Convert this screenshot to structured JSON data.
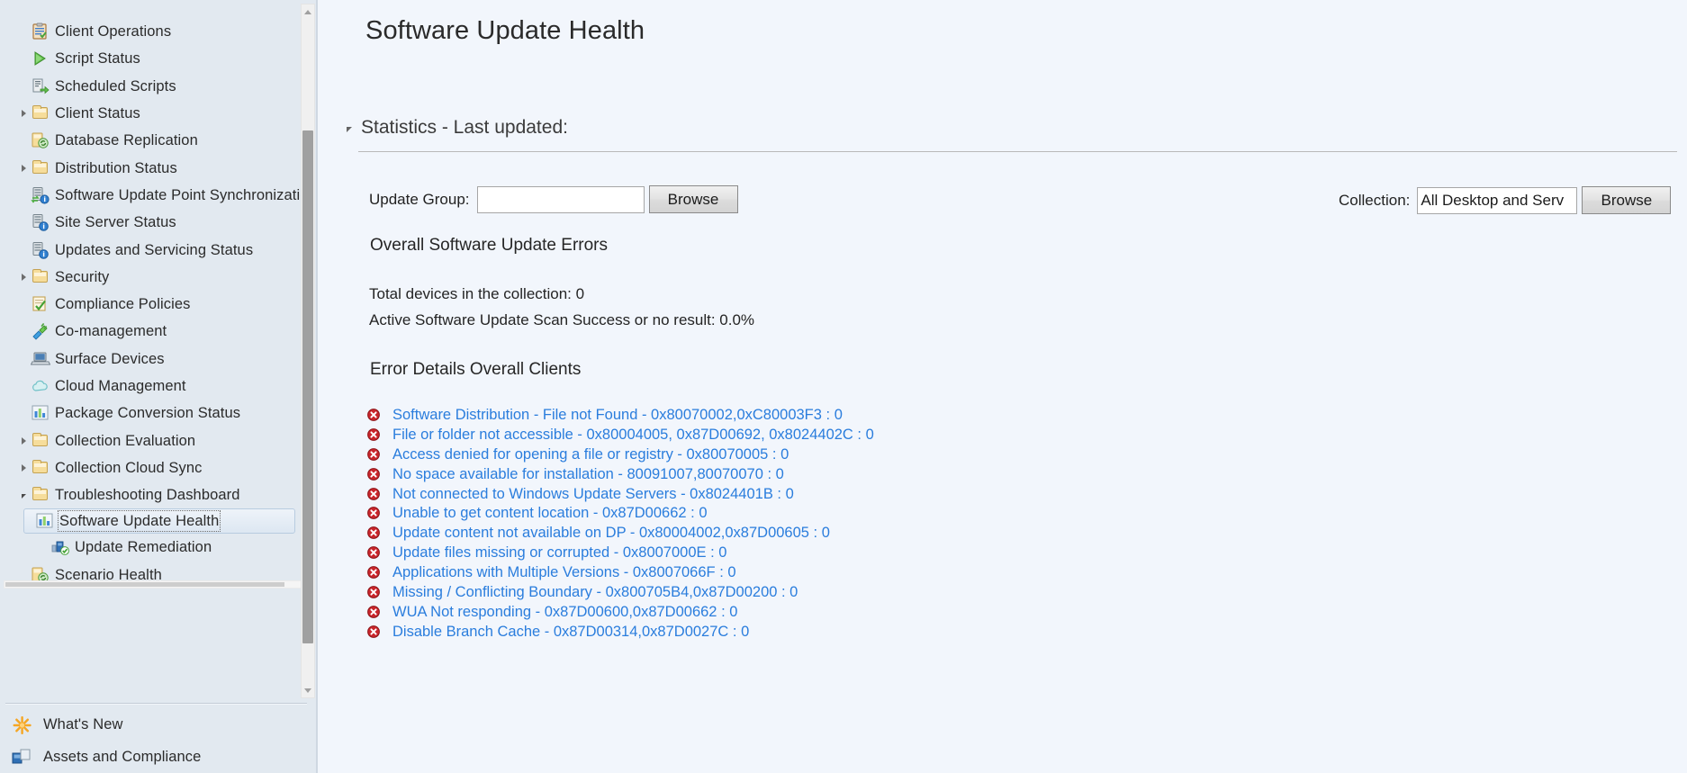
{
  "sidebar": {
    "items": [
      {
        "label": "Client Operations",
        "icon": "clipboard-tasks-icon",
        "indent": 1,
        "twisty": "none",
        "selected": false
      },
      {
        "label": "Script Status",
        "icon": "play-green-icon",
        "indent": 1,
        "twisty": "none",
        "selected": false
      },
      {
        "label": "Scheduled Scripts",
        "icon": "script-arrow-icon",
        "indent": 1,
        "twisty": "none",
        "selected": false
      },
      {
        "label": "Client Status",
        "icon": "folder-icon",
        "indent": 1,
        "twisty": "collapsed",
        "selected": false
      },
      {
        "label": "Database Replication",
        "icon": "database-sync-icon",
        "indent": 1,
        "twisty": "none",
        "selected": false
      },
      {
        "label": "Distribution Status",
        "icon": "folder-icon",
        "indent": 1,
        "twisty": "collapsed",
        "selected": false
      },
      {
        "label": "Software Update Point Synchronization Sta",
        "icon": "server-sync-info-icon",
        "indent": 1,
        "twisty": "none",
        "selected": false
      },
      {
        "label": "Site Server Status",
        "icon": "server-info-icon",
        "indent": 1,
        "twisty": "none",
        "selected": false
      },
      {
        "label": "Updates and Servicing Status",
        "icon": "server-info-icon",
        "indent": 1,
        "twisty": "none",
        "selected": false
      },
      {
        "label": "Security",
        "icon": "folder-icon",
        "indent": 1,
        "twisty": "collapsed",
        "selected": false
      },
      {
        "label": "Compliance Policies",
        "icon": "checklist-green-icon",
        "indent": 1,
        "twisty": "none",
        "selected": false
      },
      {
        "label": "Co-management",
        "icon": "plug-connect-icon",
        "indent": 1,
        "twisty": "none",
        "selected": false
      },
      {
        "label": "Surface Devices",
        "icon": "laptop-icon",
        "indent": 1,
        "twisty": "none",
        "selected": false
      },
      {
        "label": "Cloud Management",
        "icon": "cloud-icon",
        "indent": 1,
        "twisty": "none",
        "selected": false
      },
      {
        "label": "Package Conversion Status",
        "icon": "bar-chart-icon",
        "indent": 1,
        "twisty": "none",
        "selected": false
      },
      {
        "label": "Collection Evaluation",
        "icon": "folder-icon",
        "indent": 1,
        "twisty": "collapsed",
        "selected": false
      },
      {
        "label": "Collection Cloud Sync",
        "icon": "folder-icon",
        "indent": 1,
        "twisty": "collapsed",
        "selected": false
      },
      {
        "label": "Troubleshooting Dashboard",
        "icon": "folder-icon",
        "indent": 1,
        "twisty": "expanded",
        "selected": false
      },
      {
        "label": "Software Update Health",
        "icon": "bar-chart-icon",
        "indent": 2,
        "twisty": "none",
        "selected": true
      },
      {
        "label": "Update Remediation",
        "icon": "remediation-icon",
        "indent": 2,
        "twisty": "none",
        "selected": false
      },
      {
        "label": "Scenario Health",
        "icon": "database-sync-icon",
        "indent": 1,
        "twisty": "none",
        "selected": false
      }
    ],
    "bottom_items": [
      {
        "label": "What's New",
        "icon": "starburst-icon"
      },
      {
        "label": "Assets and Compliance",
        "icon": "assets-compliance-icon"
      }
    ]
  },
  "main": {
    "title": "Software Update Health",
    "section": {
      "title": "Statistics - Last updated:",
      "twisty": "expanded"
    },
    "form": {
      "update_group": {
        "label": "Update Group:",
        "value": "",
        "placeholder": "",
        "browse_label": "Browse"
      },
      "collection": {
        "label": "Collection:",
        "value": "All Desktop and Serv",
        "placeholder": "",
        "browse_label": "Browse"
      }
    },
    "overall_heading": "Overall Software Update Errors",
    "stats": [
      "Total devices in the collection: 0",
      "Active Software Update Scan Success or no result: 0.0%"
    ],
    "error_details_heading": "Error Details Overall Clients",
    "errors": [
      {
        "icon": "error-icon",
        "text": "Software Distribution - File not Found - 0x80070002,0xC80003F3 : 0"
      },
      {
        "icon": "error-icon",
        "text": "File or folder not accessible - 0x80004005, 0x87D00692, 0x8024402C : 0"
      },
      {
        "icon": "error-icon",
        "text": "Access denied for opening a file or registry - 0x80070005 : 0"
      },
      {
        "icon": "error-icon",
        "text": "No space available for installation - 80091007,80070070 : 0"
      },
      {
        "icon": "error-icon",
        "text": "Not connected to Windows Update Servers - 0x8024401B  : 0"
      },
      {
        "icon": "error-icon",
        "text": "Unable to get content location - 0x87D00662  : 0"
      },
      {
        "icon": "error-icon",
        "text": "Update content not available on DP - 0x80004002,0x87D00605 : 0"
      },
      {
        "icon": "error-icon",
        "text": "Update files missing or corrupted - 0x8007000E : 0"
      },
      {
        "icon": "error-icon",
        "text": "Applications with Multiple Versions - 0x8007066F : 0"
      },
      {
        "icon": "error-icon",
        "text": "Missing / Conflicting Boundary - 0x800705B4,0x87D00200 : 0"
      },
      {
        "icon": "error-icon",
        "text": "WUA Not responding - 0x87D00600,0x87D00662 : 0"
      },
      {
        "icon": "error-icon",
        "text": "Disable Branch Cache - 0x87D00314,0x87D0027C : 0"
      }
    ]
  },
  "colors": {
    "sidebar_bg": "#e2e9f0",
    "content_bg": "#f2f6fc",
    "link_blue": "#2a7ddd",
    "error_red": "#cc2b2b",
    "selection_border": "#b8cce0"
  }
}
